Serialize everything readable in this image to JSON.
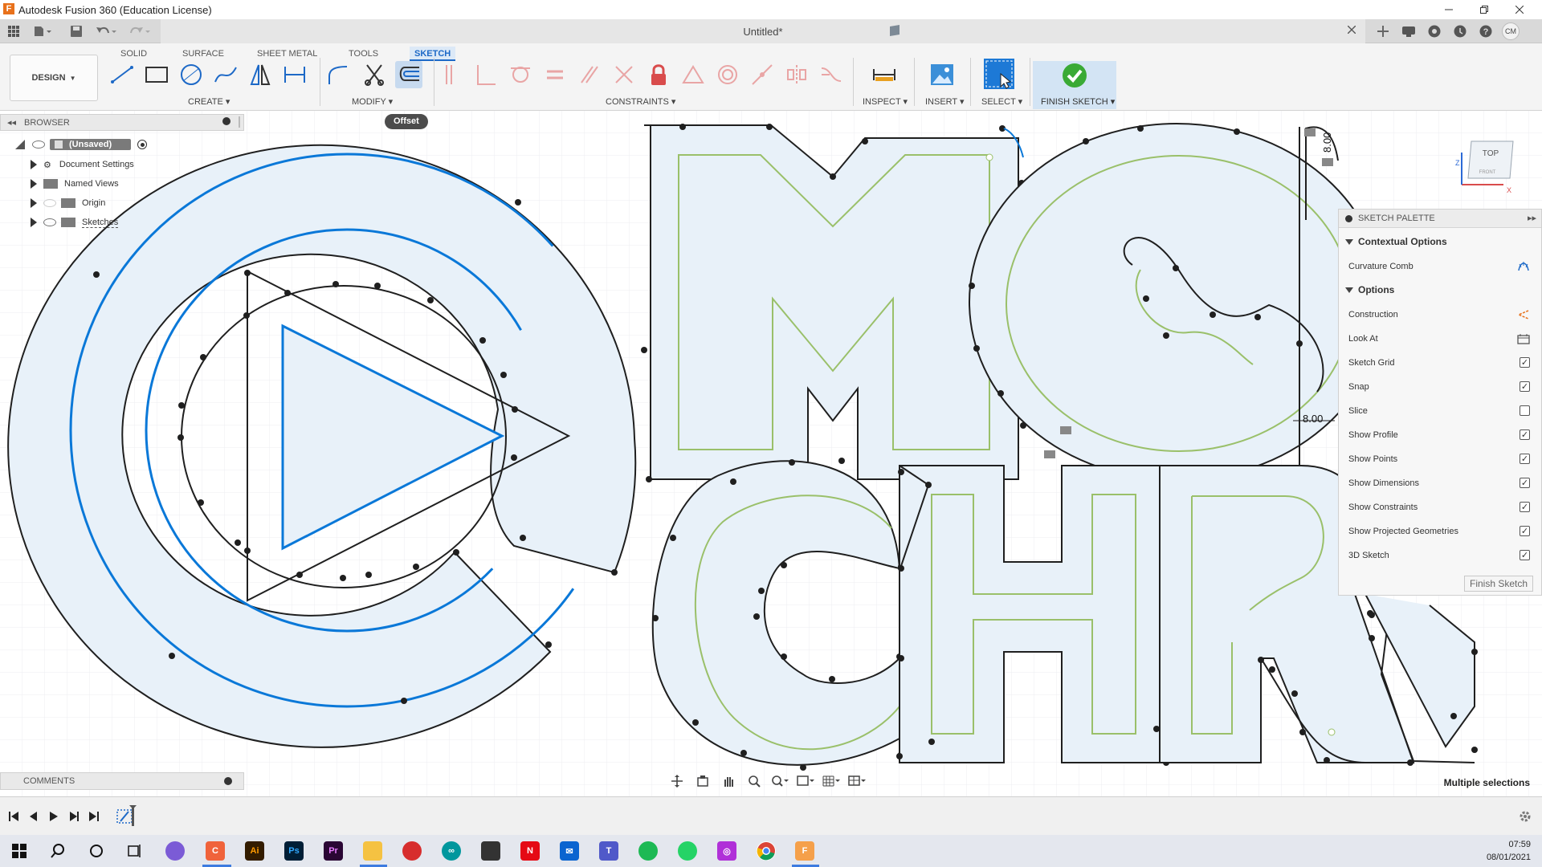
{
  "window": {
    "title": "Autodesk Fusion 360 (Education License)",
    "app_logo": "F",
    "document_title": "Untitled*"
  },
  "quick_access": {
    "icons": [
      "apps-grid-icon",
      "file-icon",
      "save-icon",
      "undo-icon",
      "redo-icon"
    ]
  },
  "user": {
    "initials": "CM"
  },
  "ribbon": {
    "tabs": [
      {
        "label": "SOLID"
      },
      {
        "label": "SURFACE"
      },
      {
        "label": "SHEET METAL"
      },
      {
        "label": "TOOLS"
      },
      {
        "label": "SKETCH",
        "active": true
      }
    ],
    "workspace": "DESIGN",
    "groups": {
      "create": "CREATE",
      "modify": "MODIFY",
      "constraints": "CONSTRAINTS",
      "inspect": "INSPECT",
      "insert": "INSERT",
      "select": "SELECT",
      "finish": "FINISH SKETCH"
    },
    "tooltip": "Offset"
  },
  "browser": {
    "header": "BROWSER",
    "root": "(Unsaved)",
    "items": [
      {
        "label": "Document Settings"
      },
      {
        "label": "Named Views"
      },
      {
        "label": "Origin"
      },
      {
        "label": "Sketches"
      }
    ]
  },
  "sketch_palette": {
    "title": "SKETCH PALETTE",
    "contextual_title": "Contextual Options",
    "contextual": [
      {
        "label": "Curvature Comb",
        "icon": "curvature-comb-icon"
      }
    ],
    "options_title": "Options",
    "options": [
      {
        "label": "Construction",
        "type": "icon",
        "icon": "construction-icon"
      },
      {
        "label": "Look At",
        "type": "icon",
        "icon": "look-at-icon"
      },
      {
        "label": "Sketch Grid",
        "type": "checkbox",
        "checked": true
      },
      {
        "label": "Snap",
        "type": "checkbox",
        "checked": true
      },
      {
        "label": "Slice",
        "type": "checkbox",
        "checked": false
      },
      {
        "label": "Show Profile",
        "type": "checkbox",
        "checked": true
      },
      {
        "label": "Show Points",
        "type": "checkbox",
        "checked": true
      },
      {
        "label": "Show Dimensions",
        "type": "checkbox",
        "checked": true
      },
      {
        "label": "Show Constraints",
        "type": "checkbox",
        "checked": true
      },
      {
        "label": "Show Projected Geometries",
        "type": "checkbox",
        "checked": true
      },
      {
        "label": "3D Sketch",
        "type": "checkbox",
        "checked": true
      }
    ],
    "finish_button": "Finish Sketch"
  },
  "canvas": {
    "dimension_1": "8.00",
    "dimension_2": "8.00",
    "viewcube_top": "TOP",
    "viewcube_front": "FRONT",
    "axis_z": "Z",
    "axis_x": "X",
    "sketch_color": "#0a78d8",
    "profile_fill": "#e8f1f9",
    "construction_color": "#9ac06a"
  },
  "comments": {
    "label": "COMMENTS"
  },
  "status": {
    "selection": "Multiple selections"
  },
  "taskbar": {
    "time": "07:59",
    "date": "08/01/2021"
  }
}
